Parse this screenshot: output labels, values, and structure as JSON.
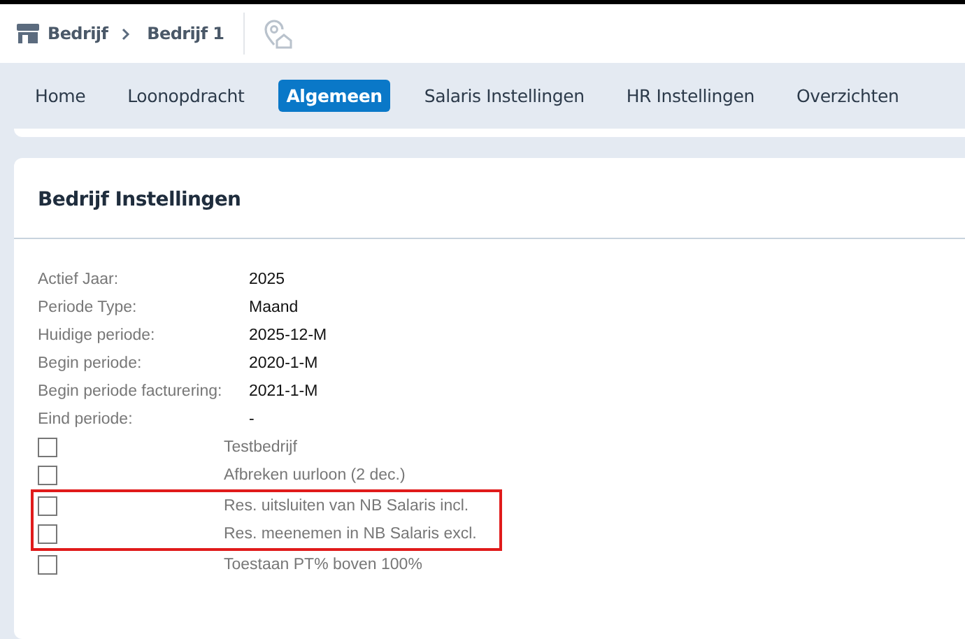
{
  "breadcrumb": {
    "items": [
      "Bedrijf",
      "Bedrijf 1"
    ]
  },
  "tabs": [
    {
      "label": "Home",
      "selected": false
    },
    {
      "label": "Loonopdracht",
      "selected": false
    },
    {
      "label": "Algemeen",
      "selected": true
    },
    {
      "label": "Salaris Instellingen",
      "selected": false
    },
    {
      "label": "HR Instellingen",
      "selected": false
    },
    {
      "label": "Overzichten",
      "selected": false
    }
  ],
  "card": {
    "title": "Bedrijf Instellingen",
    "fields": [
      {
        "label": "Actief Jaar:",
        "value": "2025"
      },
      {
        "label": "Periode Type:",
        "value": "Maand"
      },
      {
        "label": "Huidige periode:",
        "value": "2025-12-M"
      },
      {
        "label": "Begin periode:",
        "value": "2020-1-M"
      },
      {
        "label": "Begin periode facturering:",
        "value": "2021-1-M"
      },
      {
        "label": "Eind periode:",
        "value": "-"
      }
    ],
    "checkboxes": [
      {
        "label": "Testbedrijf",
        "checked": false,
        "highlighted": false
      },
      {
        "label": "Afbreken uurloon (2 dec.)",
        "checked": false,
        "highlighted": false
      },
      {
        "label": "Res. uitsluiten van NB Salaris incl.",
        "checked": false,
        "highlighted": true
      },
      {
        "label": "Res. meenemen in NB Salaris excl.",
        "checked": false,
        "highlighted": true
      },
      {
        "label": "Toestaan PT% boven 100%",
        "checked": false,
        "highlighted": false
      }
    ]
  }
}
